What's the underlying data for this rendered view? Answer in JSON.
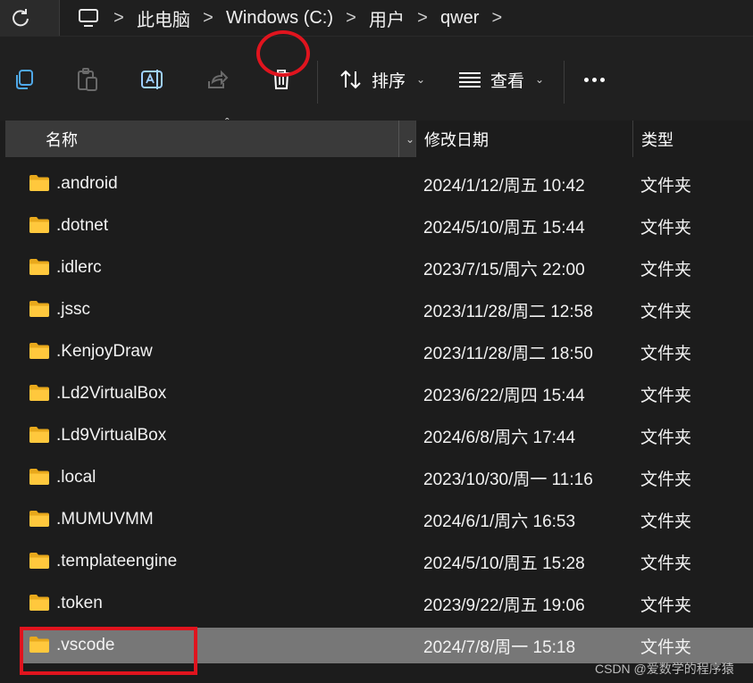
{
  "address_bar": {
    "refresh_icon": "refresh-icon",
    "pc_icon": "computer-icon",
    "separator": ">",
    "breadcrumbs": [
      "此电脑",
      "Windows (C:)",
      "用户",
      "qwer"
    ]
  },
  "command_bar": {
    "copy_icon": "copy-icon",
    "paste_icon": "paste-icon",
    "rename_icon": "rename-icon",
    "share_icon": "share-icon",
    "delete_icon": "trash-icon",
    "sort_label": "排序",
    "view_label": "查看",
    "more_icon": "more-icon",
    "highlight_color": "#e0141e"
  },
  "columns": {
    "name": "名称",
    "date": "修改日期",
    "type": "类型"
  },
  "files": [
    {
      "name": ".android",
      "date": "2024/1/12/周五 10:42",
      "type": "文件夹",
      "selected": false
    },
    {
      "name": ".dotnet",
      "date": "2024/5/10/周五 15:44",
      "type": "文件夹",
      "selected": false
    },
    {
      "name": ".idlerc",
      "date": "2023/7/15/周六 22:00",
      "type": "文件夹",
      "selected": false
    },
    {
      "name": ".jssc",
      "date": "2023/11/28/周二 12:58",
      "type": "文件夹",
      "selected": false
    },
    {
      "name": ".KenjoyDraw",
      "date": "2023/11/28/周二 18:50",
      "type": "文件夹",
      "selected": false
    },
    {
      "name": ".Ld2VirtualBox",
      "date": "2023/6/22/周四 15:44",
      "type": "文件夹",
      "selected": false
    },
    {
      "name": ".Ld9VirtualBox",
      "date": "2024/6/8/周六 17:44",
      "type": "文件夹",
      "selected": false
    },
    {
      "name": ".local",
      "date": "2023/10/30/周一 11:16",
      "type": "文件夹",
      "selected": false
    },
    {
      "name": ".MUMUVMM",
      "date": "2024/6/1/周六 16:53",
      "type": "文件夹",
      "selected": false
    },
    {
      "name": ".templateengine",
      "date": "2024/5/10/周五 15:28",
      "type": "文件夹",
      "selected": false
    },
    {
      "name": ".token",
      "date": "2023/9/22/周五 19:06",
      "type": "文件夹",
      "selected": false
    },
    {
      "name": ".vscode",
      "date": "2024/7/8/周一 15:18",
      "type": "文件夹",
      "selected": true
    }
  ],
  "watermark": "CSDN @爱数学的程序猿"
}
